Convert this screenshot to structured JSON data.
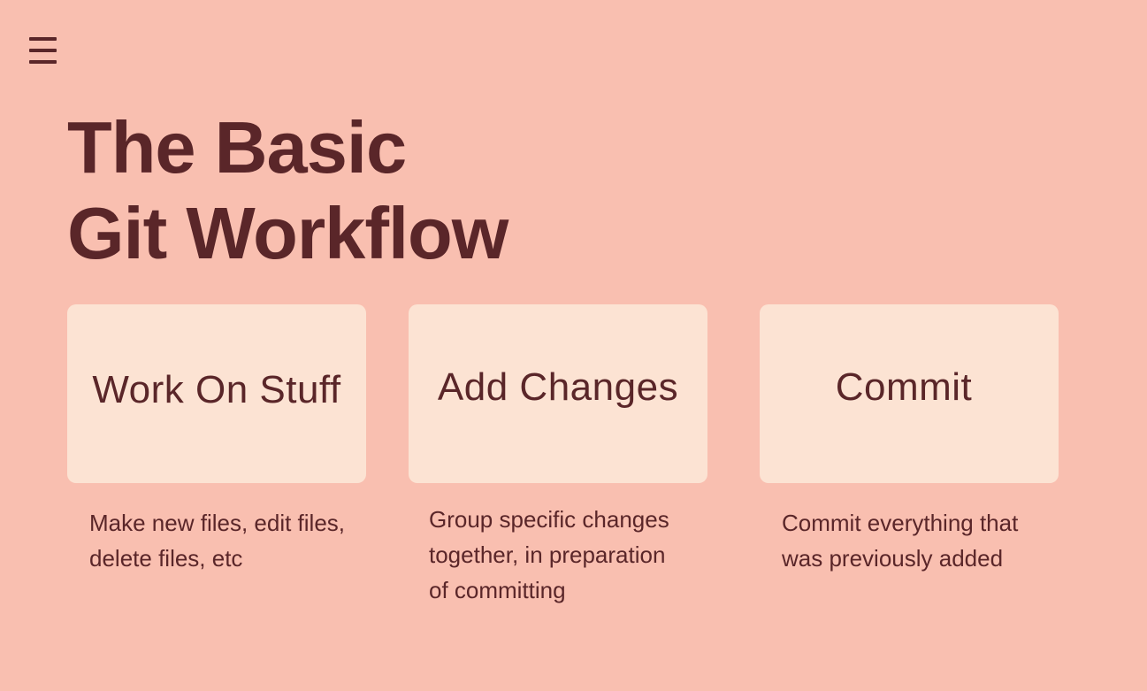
{
  "header": {
    "menu_icon": "hamburger-menu-icon"
  },
  "title": {
    "line1": "The Basic",
    "line2": "Git Workflow"
  },
  "steps": [
    {
      "label": "Work On Stuff",
      "description": "Make new files, edit files, delete files, etc"
    },
    {
      "label": "Add Changes",
      "description": "Group specific changes together, in preparation of committing"
    },
    {
      "label": "Commit",
      "description": "Commit everything that was previously added"
    }
  ],
  "colors": {
    "background": "#f9bfb0",
    "card": "#fce3d3",
    "text": "#5a2629"
  }
}
